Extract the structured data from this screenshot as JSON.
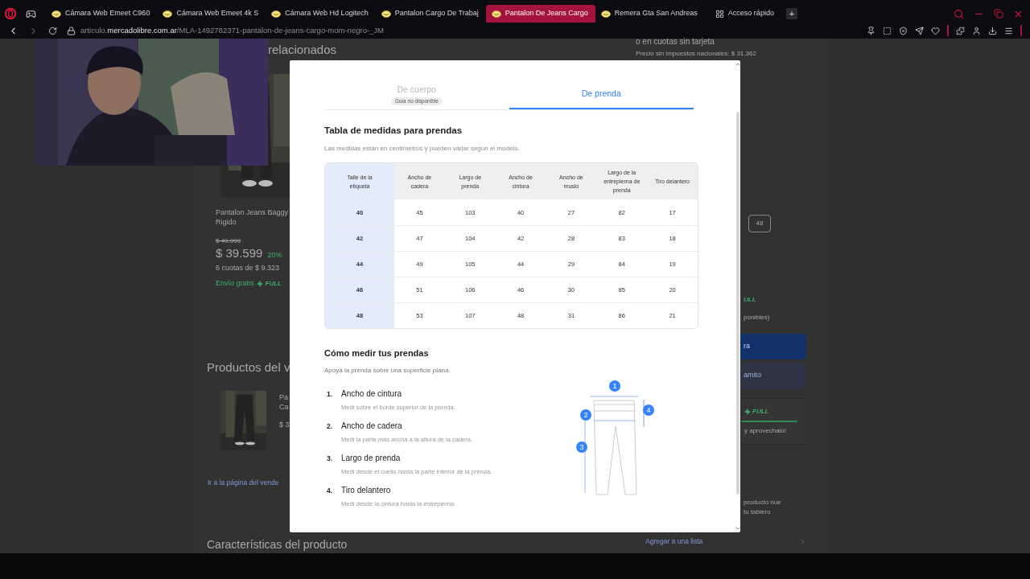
{
  "browser": {
    "tabs": [
      {
        "title": "Cámara Web Emeet C960",
        "kind": "page",
        "selected": false
      },
      {
        "title": "Cámara Web Emeet 4k S",
        "kind": "page",
        "selected": false
      },
      {
        "title": "Cámara Web Hd Logitech",
        "kind": "page",
        "selected": false
      },
      {
        "title": "Pantalon Cargo De Trabaj",
        "kind": "page",
        "selected": false
      },
      {
        "title": "Pantalon De Jeans Cargo",
        "kind": "page",
        "selected": true
      },
      {
        "title": "Remera Gta San Andreas",
        "kind": "page",
        "selected": false
      },
      {
        "title": "Acceso rápido",
        "kind": "speed_dial",
        "selected": false
      }
    ],
    "new_tab": "+",
    "address": {
      "prefix": "articulo.",
      "domain": "mercadolibre.com.ar",
      "path": "/MLA-1492782371-pantalon-de-jeans-cargo-mom-negro-_JM"
    }
  },
  "page": {
    "related_heading": "relacionados",
    "product": {
      "title_lines": [
        "Pantalon Jeans Baggy",
        "Rigido"
      ],
      "old_price": "$ 49.999",
      "price": "$ 39.599",
      "discount": "20%",
      "installments": "6 cuotas de $ 9.323",
      "shipping": "Envío gratis",
      "full": "FULL"
    },
    "seller_heading": "Productos del v",
    "seller_product": {
      "title_lines": [
        "Pa",
        "Ca"
      ],
      "price": "$ 3"
    },
    "seller_link": "Ir a la página del vende",
    "features_heading": "Características del producto"
  },
  "buy_box": {
    "installments": "o en cuotas sin tarjeta",
    "tax_note": "Precio sin impuestos nacionales: $ 31.362",
    "size": "48",
    "full": "ULL",
    "stock_note": "ponibles)",
    "primary": "ra",
    "secondary": "amito",
    "promo_full": "FULL",
    "promo_text": "y aprovechalo!",
    "note_lines": [
      "producto nue",
      "tu tablero"
    ],
    "list_link": "Agregar a una lista"
  },
  "modal": {
    "tabs": [
      {
        "label": "De cuerpo",
        "badge": "Guía no disponible",
        "selected": false,
        "disabled": true
      },
      {
        "label": "De prenda",
        "selected": true,
        "disabled": false
      }
    ],
    "title": "Tabla de medidas para prendas",
    "subtitle": "Las medidas están en centímetros y pueden variar según el modelo.",
    "table": {
      "columns": [
        "Talle de la etiqueta",
        "Ancho de cadera",
        "Largo de prenda",
        "Ancho de cintura",
        "Ancho de muslo",
        "Largo de la entrepierna de prenda",
        "Tiro delantero"
      ],
      "rows": [
        [
          "40",
          "45",
          "103",
          "40",
          "27",
          "82",
          "17"
        ],
        [
          "42",
          "47",
          "104",
          "42",
          "28",
          "83",
          "18"
        ],
        [
          "44",
          "49",
          "105",
          "44",
          "29",
          "84",
          "19"
        ],
        [
          "46",
          "51",
          "106",
          "46",
          "30",
          "85",
          "20"
        ],
        [
          "48",
          "53",
          "107",
          "48",
          "31",
          "86",
          "21"
        ]
      ]
    },
    "howto": {
      "title": "Cómo medir tus prendas",
      "subtitle": "Apoyá la prenda sobre una superficie plana.",
      "steps": [
        {
          "number": "1.",
          "title": "Ancho de cintura",
          "text": "Medí sobre el borde superior de la prenda."
        },
        {
          "number": "2.",
          "title": "Ancho de cadera",
          "text": "Medí la parte más ancha a la altura de la cadera."
        },
        {
          "number": "3.",
          "title": "Largo de prenda",
          "text": "Medí desde el cuello hasta la parte inferior de la prenda."
        },
        {
          "number": "4.",
          "title": "Tiro delantero",
          "text": "Medí desde la cintura hasta la entrepierna."
        }
      ],
      "markers": [
        "1",
        "2",
        "3",
        "4"
      ]
    }
  }
}
